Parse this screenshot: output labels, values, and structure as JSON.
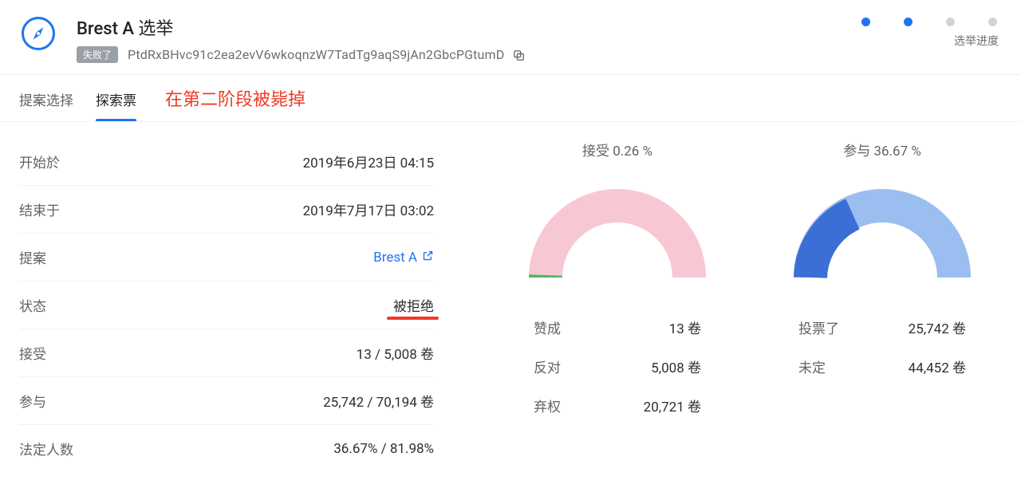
{
  "header": {
    "title": "Brest A 选举",
    "fail_badge": "失败了",
    "hash": "PtdRxBHvc91c2ea2evV6wkoqnzW7TadTg9aqS9jAn2GbcPGtumD",
    "progress_label": "选举进度"
  },
  "tabs": {
    "proposal": "提案选择",
    "explore": "探索票",
    "callout": "在第二阶段被毙掉"
  },
  "details": {
    "start_label": "开始於",
    "start_value": "2019年6月23日 04:15",
    "end_label": "结束于",
    "end_value": "2019年7月17日 03:02",
    "proposal_label": "提案",
    "proposal_value": "Brest A",
    "status_label": "状态",
    "status_value": "被拒绝",
    "accept_label": "接受",
    "accept_value": "13 / 5,008 卷",
    "participate_label": "参与",
    "participate_value": "25,742 / 70,194 卷",
    "quorum_label": "法定人数",
    "quorum_value": "36.67% / 81.98%"
  },
  "acceptChart": {
    "title": "接受 0.26 %",
    "yes_label": "赞成",
    "yes_value": "13 卷",
    "no_label": "反对",
    "no_value": "5,008 卷",
    "abstain_label": "弃权",
    "abstain_value": "20,721 卷"
  },
  "participateChart": {
    "title": "参与 36.67 %",
    "voted_label": "投票了",
    "voted_value": "25,742 卷",
    "undecided_label": "未定",
    "undecided_value": "44,452 卷"
  },
  "chart_data": [
    {
      "type": "pie",
      "title": "接受 0.26 %",
      "series": [
        {
          "name": "赞成",
          "value": 13
        },
        {
          "name": "反对",
          "value": 5008
        },
        {
          "name": "弃权",
          "value": 20721
        }
      ],
      "acceptance_percent": 0.26
    },
    {
      "type": "pie",
      "title": "参与 36.67 %",
      "series": [
        {
          "name": "投票了",
          "value": 25742
        },
        {
          "name": "未定",
          "value": 44452
        }
      ],
      "participation_percent": 36.67
    }
  ]
}
